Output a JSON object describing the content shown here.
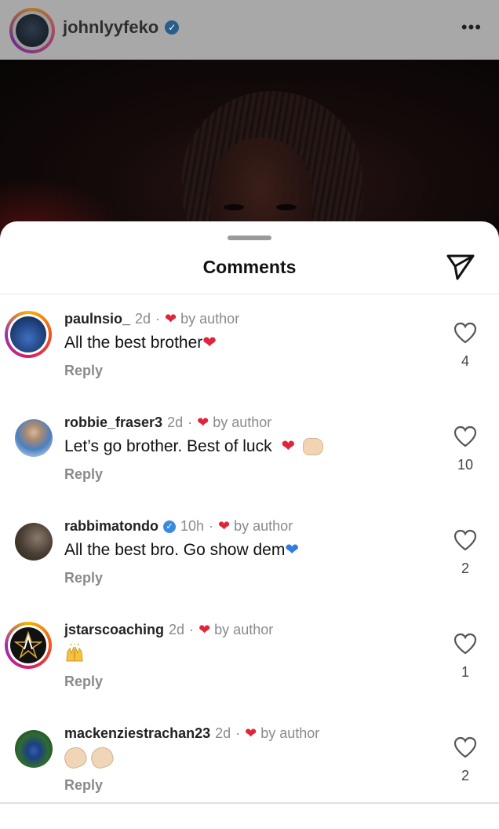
{
  "post": {
    "username": "johnlyyfeko",
    "verified_icon": "verified-badge-icon",
    "more_icon": "more-icon"
  },
  "sheet": {
    "title": "Comments",
    "send_icon": "paper-plane-icon"
  },
  "colors": {
    "heart_red": "#e0243a",
    "muted_text": "#8a8a8a",
    "verified_blue": "#3a8be0"
  },
  "comments": [
    {
      "username": "paulnsio_",
      "time": "2d",
      "verified": false,
      "liked_by_author": "by author",
      "text": "All the best brother",
      "emoji": [
        "red-heart"
      ],
      "reply_label": "Reply",
      "likes": "4"
    },
    {
      "username": "robbie_fraser3",
      "time": "2d",
      "verified": false,
      "liked_by_author": "by author",
      "text": "Let’s go brother. Best of luck",
      "emoji": [
        "red-heart",
        "fist-bump"
      ],
      "reply_label": "Reply",
      "likes": "10"
    },
    {
      "username": "rabbimatondo",
      "time": "10h",
      "verified": true,
      "liked_by_author": "by author",
      "text": "All the best bro. Go show dem",
      "emoji": [
        "blue-heart"
      ],
      "reply_label": "Reply",
      "likes": "2"
    },
    {
      "username": "jstarscoaching",
      "time": "2d",
      "verified": false,
      "liked_by_author": "by author",
      "text": "",
      "emoji": [
        "raised-hands"
      ],
      "reply_label": "Reply",
      "likes": "1"
    },
    {
      "username": "mackenziestrachan23",
      "time": "2d",
      "verified": false,
      "liked_by_author": "by author",
      "text": "",
      "emoji": [
        "clapping-hands",
        "clapping-hands"
      ],
      "reply_label": "Reply",
      "likes": "2"
    }
  ]
}
